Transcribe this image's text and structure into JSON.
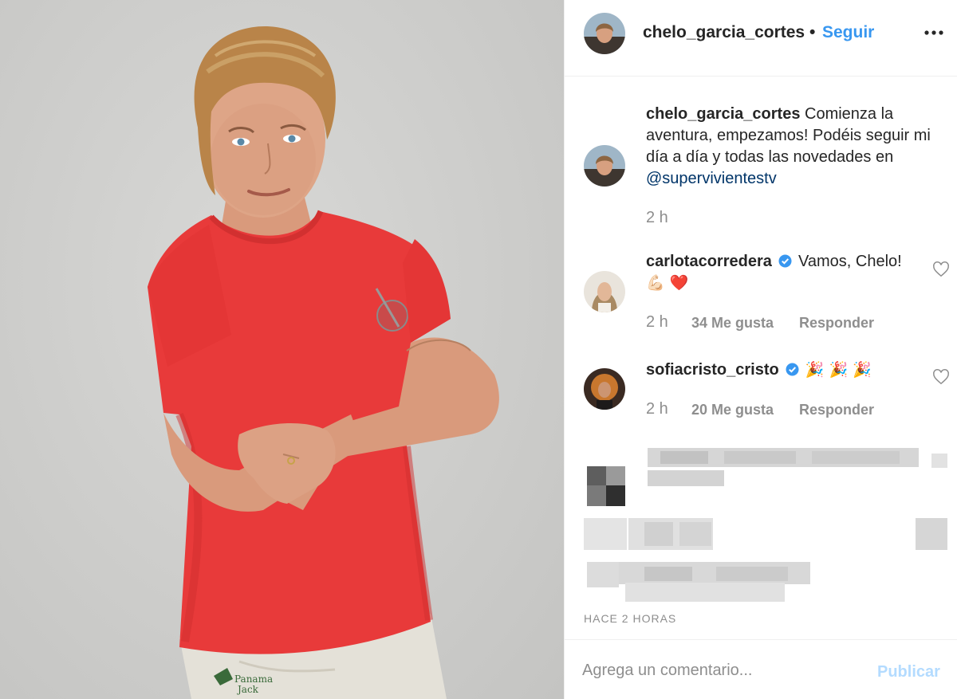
{
  "post": {
    "username": "chelo_garcia_cortes",
    "separator": "•",
    "follow_label": "Seguir",
    "more_icon": "more-horizontal-icon"
  },
  "caption": {
    "username": "chelo_garcia_cortes",
    "text": "Comienza la aventura, empezamos! Podéis seguir mi día a día y todas las novedades en",
    "mention": "@supervivientestv",
    "time": "2 h"
  },
  "comments": [
    {
      "username": "carlotacorredera",
      "verified": true,
      "text": "Vamos, Chelo!",
      "emoji": "💪🏻 ❤️",
      "time": "2 h",
      "likes": "34 Me gusta",
      "reply": "Responder"
    },
    {
      "username": "sofiacristo_cristo",
      "verified": true,
      "text": "",
      "emoji": "🎉 🎉 🎉",
      "time": "2 h",
      "likes": "20 Me gusta",
      "reply": "Responder"
    }
  ],
  "timestamp": "HACE 2 HORAS",
  "footer": {
    "placeholder": "Agrega un comentario...",
    "publish_label": "Publicar"
  },
  "colors": {
    "link": "#3897f0",
    "mention": "#003569",
    "muted": "#8e8e8e",
    "publish_disabled": "#b3dbff",
    "shirt": "#e83a3a"
  }
}
